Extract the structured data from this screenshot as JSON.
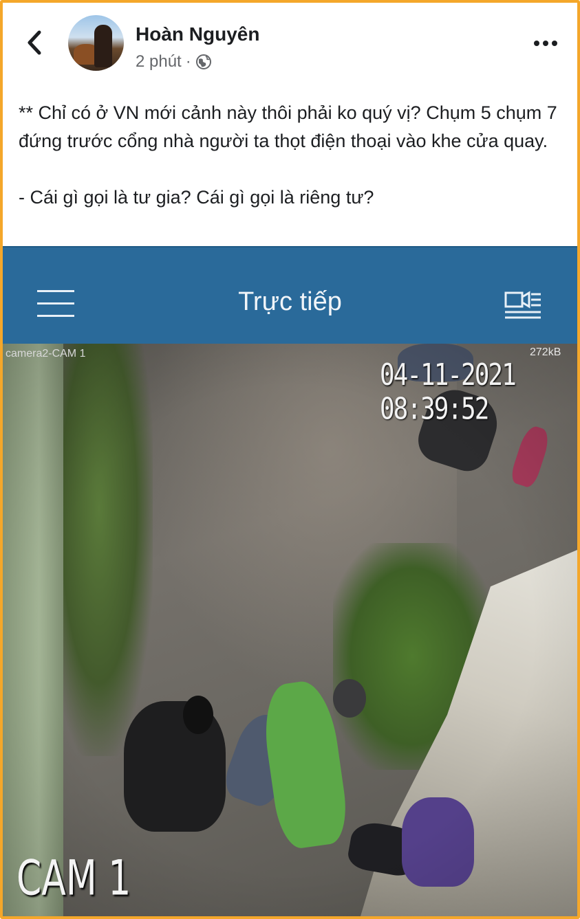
{
  "post": {
    "author_name": "Hoàn Nguyên",
    "time_label": "2 phút",
    "separator": "·",
    "text_paragraph_1": "** Chỉ có ở VN mới cảnh này thôi phải ko quý vị? Chụm 5 chụm 7 đứng trước cổng nhà người ta thọt điện thoại vào khe cửa quay.",
    "text_paragraph_2": "- Cái gì gọi là tư gia? Cái gì gọi là riêng tư?"
  },
  "icons": {
    "back": "chevron-left-icon",
    "privacy": "globe-icon",
    "more": "more-horizontal-icon",
    "menu": "hamburger-menu-icon",
    "camera_list": "camera-list-icon"
  },
  "camera_app": {
    "title": "Trực tiếp",
    "camera_name": "camera2-CAM 1",
    "bitrate": "272kB",
    "timestamp": "04-11-2021 08:39:52",
    "cam_label": "CAM 1"
  },
  "colors": {
    "frame_border": "#f4a72a",
    "app_bar": "#2a6a9a",
    "text_primary": "#1c1e21",
    "text_secondary": "#65676b"
  }
}
